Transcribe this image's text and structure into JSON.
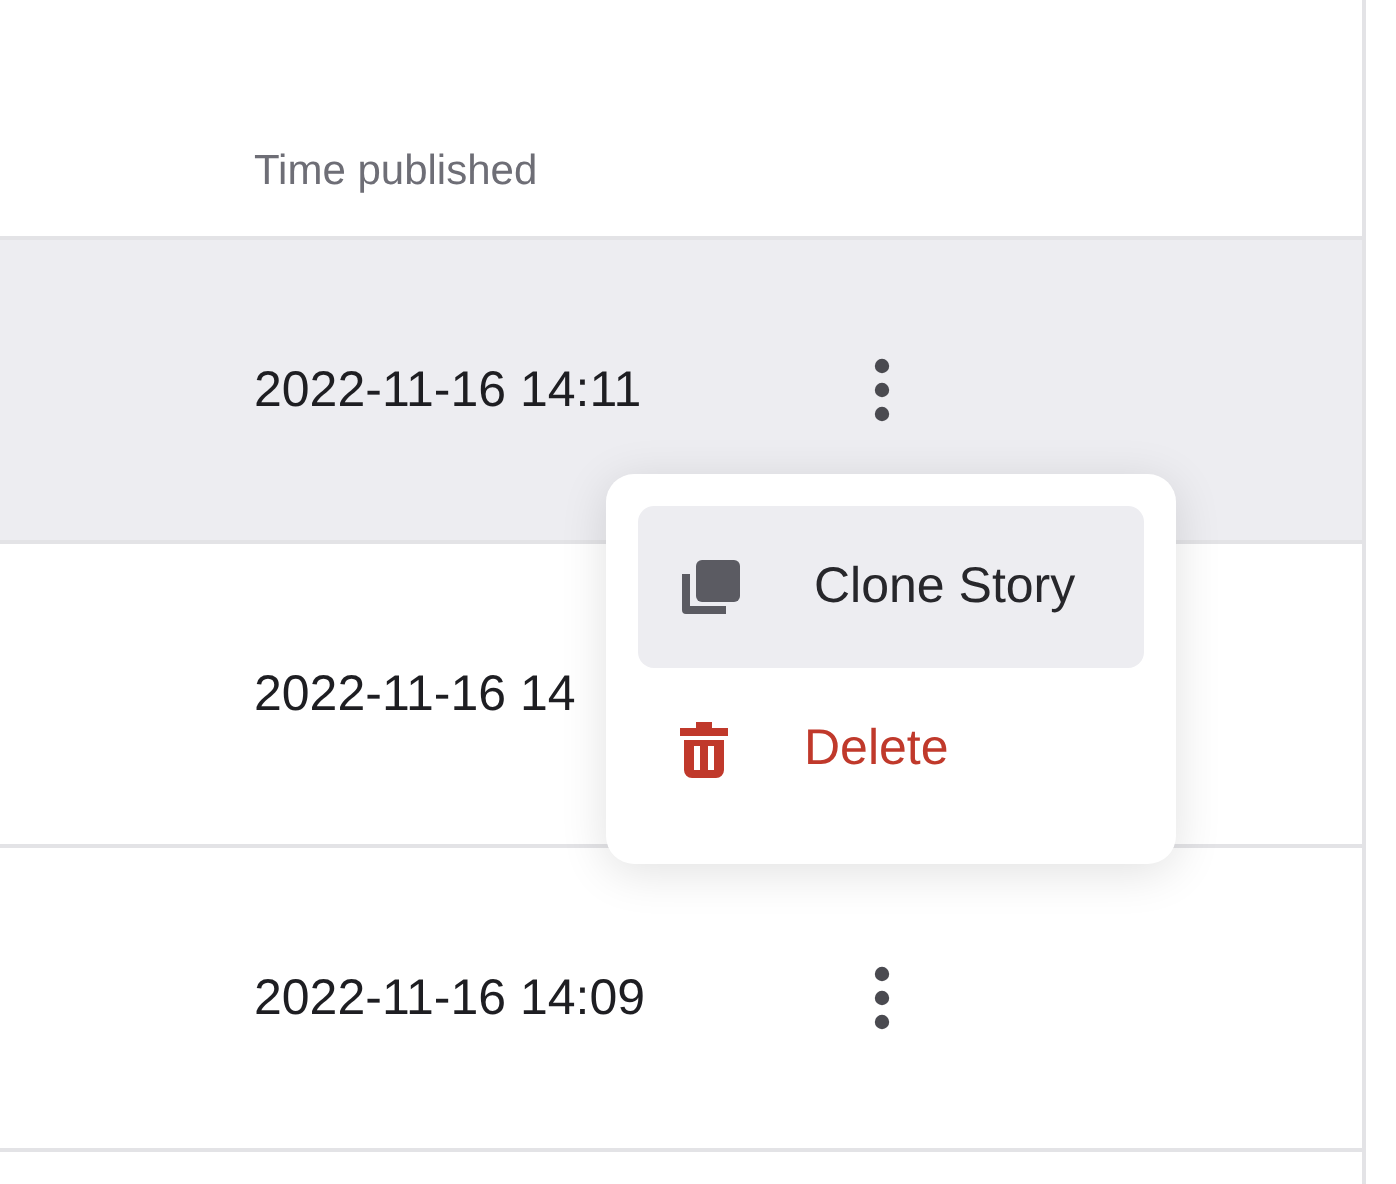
{
  "table": {
    "columns": [
      {
        "label": "Time published"
      }
    ],
    "rows": [
      {
        "time_published": "2022-11-16 14:11",
        "hovered": true,
        "actions_visible": true
      },
      {
        "time_published": "2022-11-16 14",
        "hovered": false,
        "actions_visible": false
      },
      {
        "time_published": "2022-11-16 14:09",
        "hovered": false,
        "actions_visible": true
      }
    ]
  },
  "context_menu": {
    "items": [
      {
        "label": "Clone Story",
        "kind": "clone",
        "selected": true
      },
      {
        "label": "Delete",
        "kind": "delete",
        "selected": false
      }
    ]
  }
}
